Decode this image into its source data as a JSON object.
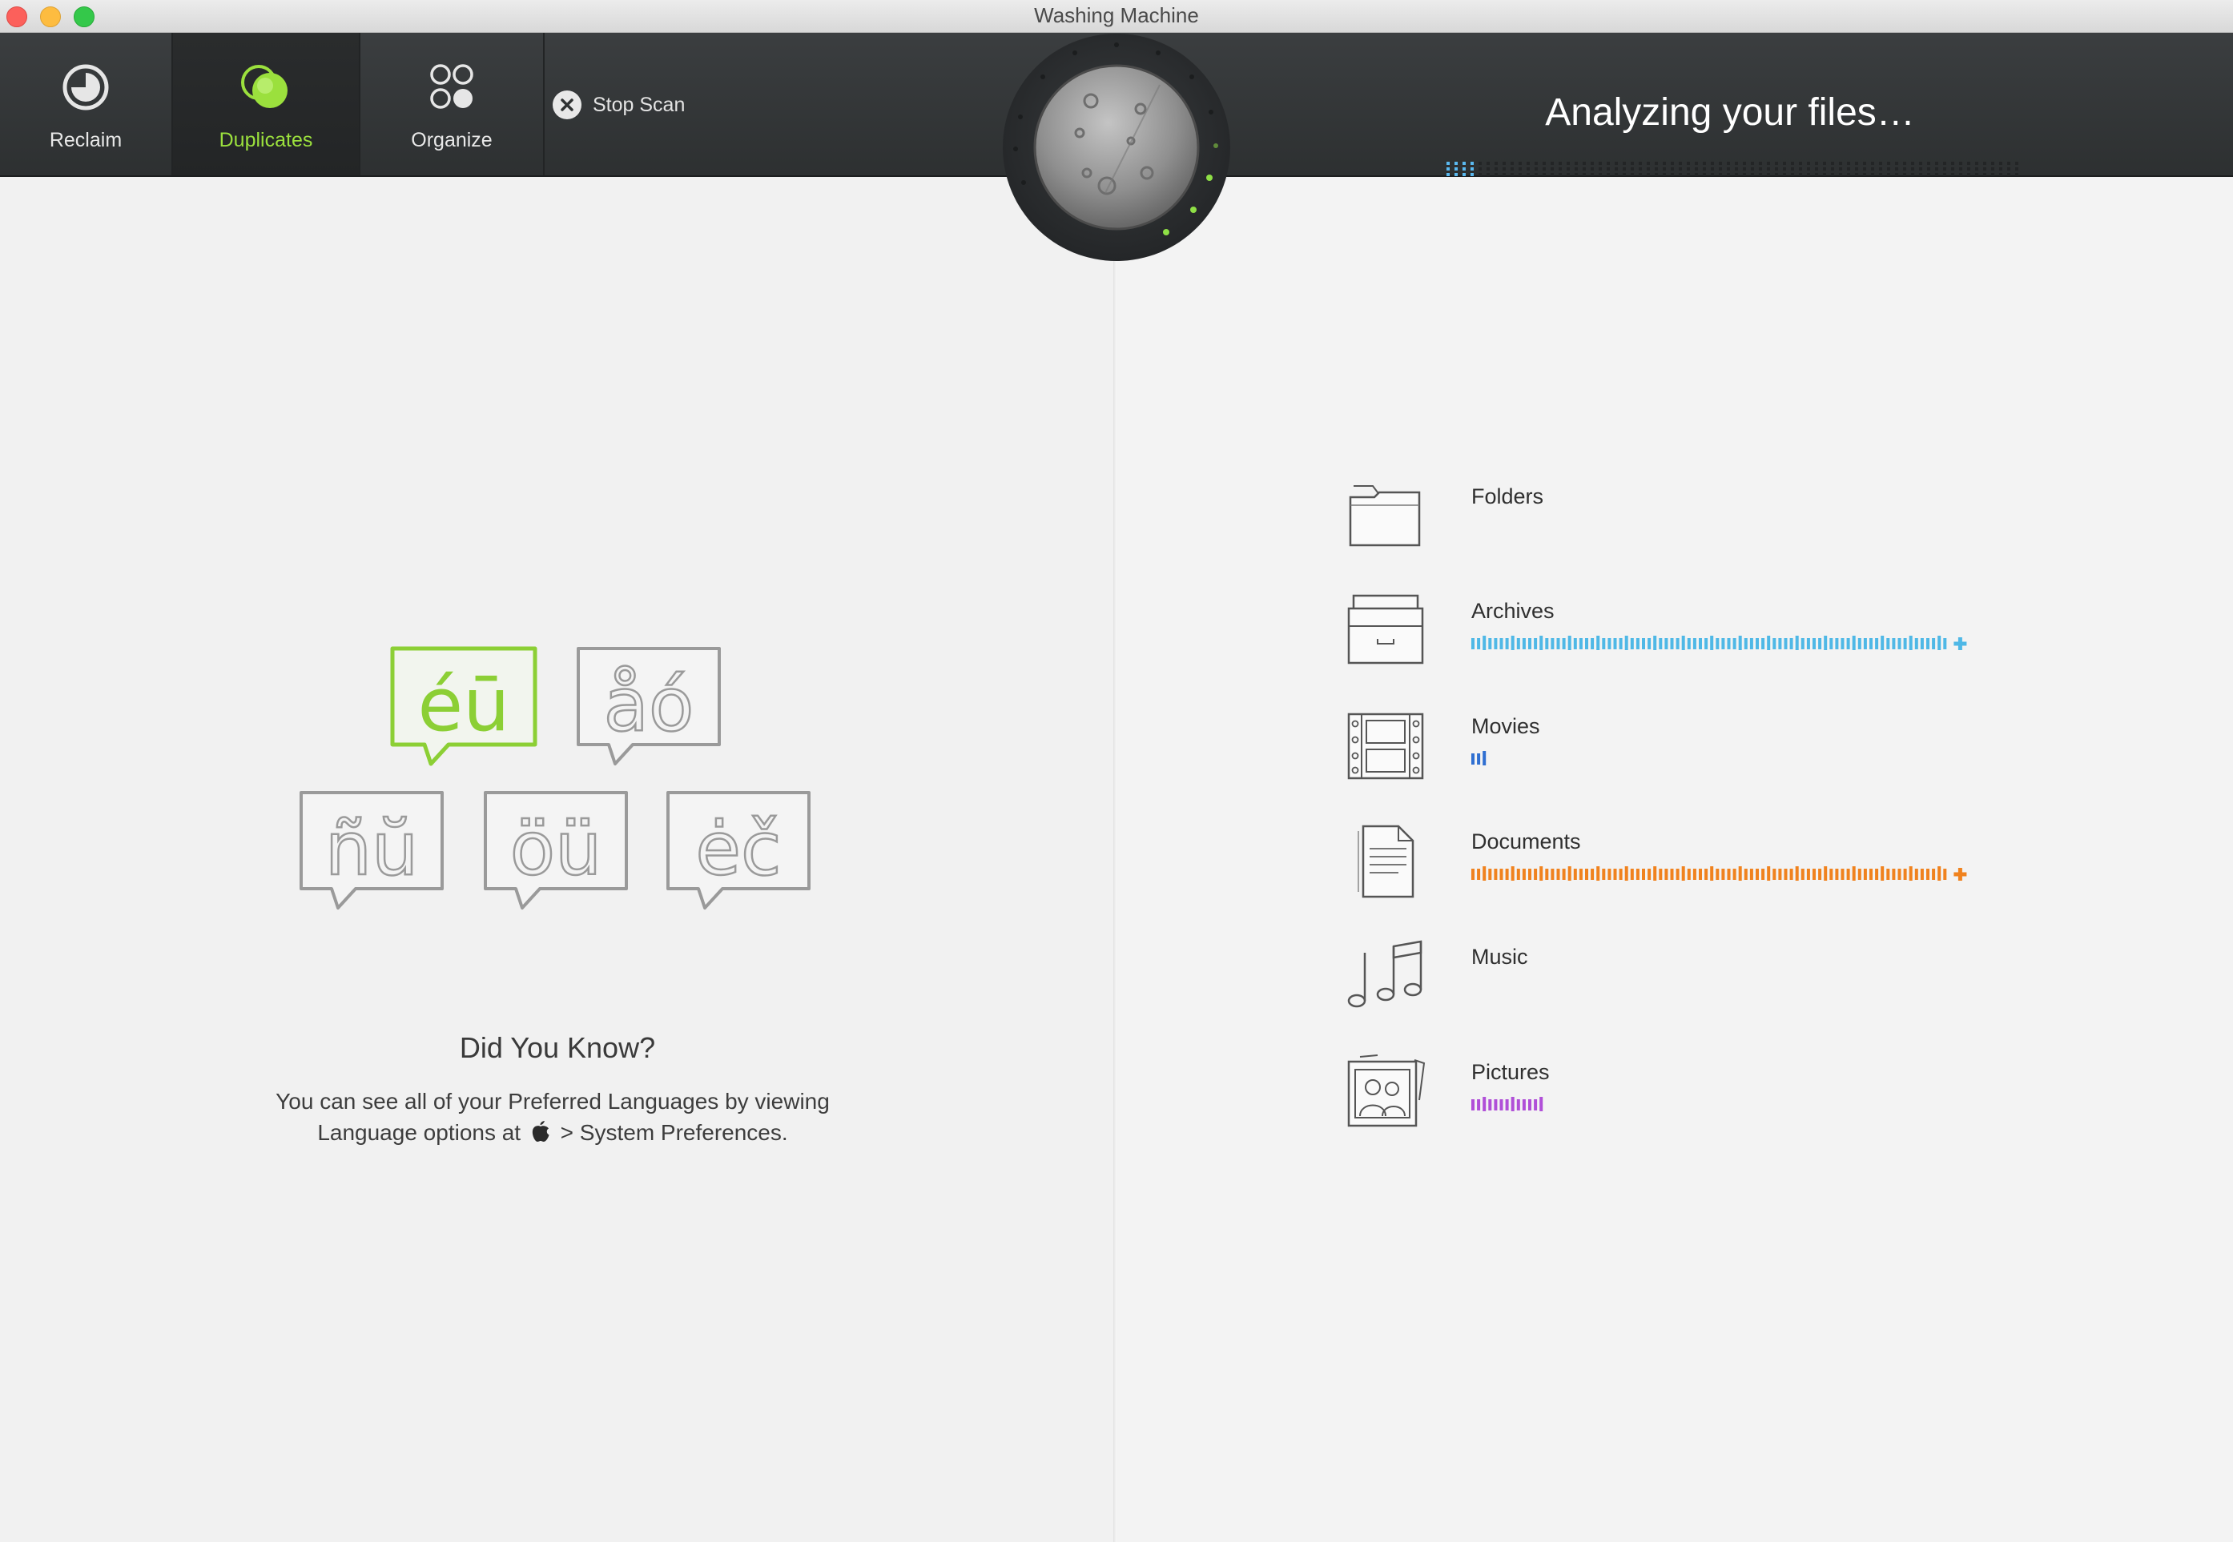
{
  "window": {
    "title": "Washing Machine"
  },
  "toolbar": {
    "tabs": [
      {
        "label": "Reclaim"
      },
      {
        "label": "Duplicates"
      },
      {
        "label": "Organize"
      }
    ],
    "stop_scan_label": "Stop Scan",
    "active_tab": "Duplicates"
  },
  "status": {
    "title": "Analyzing your files…",
    "progress_fraction": 0.05
  },
  "tip": {
    "heading": "Did You Know?",
    "line1": "You can see all of your Preferred Languages by viewing",
    "line2_prefix": "Language options at",
    "line2_suffix": "> System Preferences.",
    "bubbles": [
      "éū",
      "åó",
      "ñŭ",
      "öü",
      "ėč"
    ]
  },
  "categories": [
    {
      "name": "Folders",
      "icon": "folder-icon",
      "fraction": 0,
      "color": "",
      "overflow": false
    },
    {
      "name": "Archives",
      "icon": "archive-icon",
      "fraction": 1.0,
      "color": "#4fb8e6",
      "overflow": true
    },
    {
      "name": "Movies",
      "icon": "film-icon",
      "fraction": 0.03,
      "color": "#2f6fd1",
      "overflow": false
    },
    {
      "name": "Documents",
      "icon": "document-icon",
      "fraction": 1.0,
      "color": "#f0821e",
      "overflow": true
    },
    {
      "name": "Music",
      "icon": "music-icon",
      "fraction": 0,
      "color": "",
      "overflow": false
    },
    {
      "name": "Pictures",
      "icon": "pictures-icon",
      "fraction": 0.16,
      "color": "#b04fd8",
      "overflow": false
    }
  ],
  "colors": {
    "accent_green": "#9be03d",
    "toolbar_bg": "#2f3233"
  }
}
